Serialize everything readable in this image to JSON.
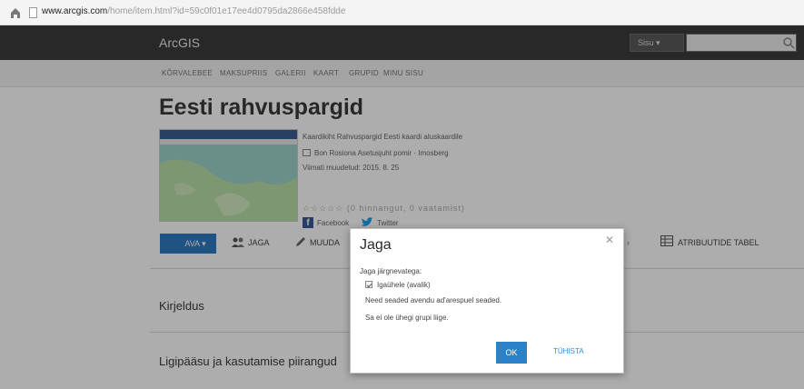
{
  "browser": {
    "url_domain": "www.arcgis.com",
    "url_path": "/home/item.html?id=59c0f01e17ee4d0795da2866e458fdde"
  },
  "header": {
    "brand": "ArcGIS",
    "search_scope": "Sisu ▾"
  },
  "nav": {
    "items": [
      "KÕRVALEBEE",
      "MAKSUPRIIS",
      "GALERII",
      "KAART",
      "GRUPID",
      "MINU SISU"
    ]
  },
  "item": {
    "title": "Eesti rahvuspargid",
    "description_line": "Kaardikiht Rahvuspargid Eesti kaardi aluskaardile",
    "owner_line": "Bon Rosiona Asetusjuht pomir · Imosberg",
    "updated_line": "Viimati muudetud: 2015. 8. 25",
    "rating_text": "☆☆☆☆☆ (0 hinnangut, 0 vaatamist)",
    "facebook_label": "Facebook",
    "twitter_label": "Twitter"
  },
  "actions": {
    "open": "AVA ▾",
    "share": "JAGA",
    "edit": "MUUDA",
    "attribute_table": "ATRIBUUTIDE TABEL"
  },
  "sections": {
    "description": "Kirjeldus",
    "access": "Ligipääsu ja kasutamise piirangud"
  },
  "dialog": {
    "title": "Jaga",
    "close": "✕",
    "share_with_label": "Jaga järgnevatega:",
    "everyone_option": "Igaühele (avalik)",
    "settings_note": "Need seaded avendu ad'arespuel seaded.",
    "groups_note": "Sa ei ole ühegi grupi liige.",
    "ok": "OK",
    "cancel": "TÜHISTA"
  },
  "colors": {
    "primary": "#2c82c9",
    "topbar": "#3c3c3c",
    "facebook": "#3b5998",
    "twitter": "#1da1f2"
  }
}
